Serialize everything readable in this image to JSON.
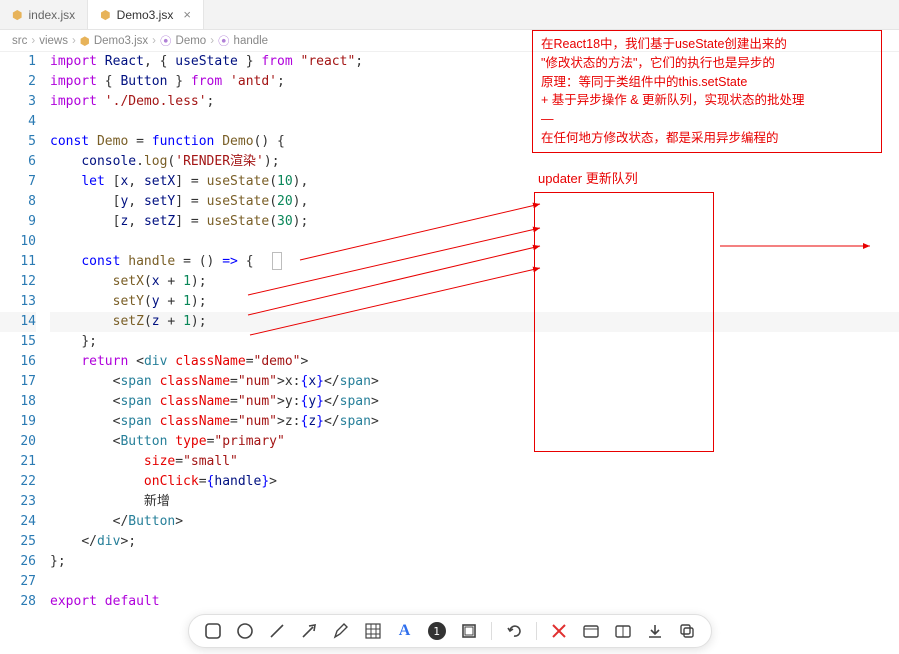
{
  "tabs": [
    {
      "label": "index.jsx",
      "active": false
    },
    {
      "label": "Demo3.jsx",
      "active": true
    }
  ],
  "breadcrumbs": {
    "parts": [
      "src",
      "views",
      "Demo3.jsx",
      "Demo",
      "handle"
    ]
  },
  "line_numbers": [
    "1",
    "2",
    "3",
    "4",
    "5",
    "6",
    "7",
    "8",
    "9",
    "10",
    "11",
    "12",
    "13",
    "14",
    "15",
    "16",
    "17",
    "18",
    "19",
    "20",
    "21",
    "22",
    "23",
    "24",
    "25",
    "26",
    "27",
    "28"
  ],
  "code": {
    "l1": {
      "a": "import",
      "b": "React",
      "c": ", { ",
      "d": "useState",
      "e": " } ",
      "f": "from",
      "g": "\"react\"",
      "h": ";"
    },
    "l2": {
      "a": "import",
      "b": " { ",
      "c": "Button",
      "d": " } ",
      "e": "from",
      "f": "'antd'",
      "g": ";"
    },
    "l3": {
      "a": "import",
      "b": "'./Demo.less'",
      "c": ";"
    },
    "l5": {
      "a": "const",
      "b": "Demo",
      "c": " = ",
      "d": "function",
      "e": "Demo",
      "f": "() {"
    },
    "l6": {
      "a": "console",
      "b": ".",
      "c": "log",
      "d": "(",
      "e": "'RENDER渲染'",
      "f": ");"
    },
    "l7": {
      "a": "let",
      "b": " [",
      "c": "x",
      "d": ", ",
      "e": "setX",
      "f": "] = ",
      "g": "useState",
      "h": "(",
      "i": "10",
      "j": "),"
    },
    "l8": {
      "a": "[",
      "b": "y",
      "c": ", ",
      "d": "setY",
      "e": "] = ",
      "f": "useState",
      "g": "(",
      "h": "20",
      "i": "),"
    },
    "l9": {
      "a": "[",
      "b": "z",
      "c": ", ",
      "d": "setZ",
      "e": "] = ",
      "f": "useState",
      "g": "(",
      "h": "30",
      "i": ");"
    },
    "l11": {
      "a": "const",
      "b": "handle",
      "c": " = () ",
      "d": "=>",
      "e": " {"
    },
    "l12": {
      "a": "setX",
      "b": "(",
      "c": "x",
      "d": " + ",
      "e": "1",
      "f": ");"
    },
    "l13": {
      "a": "setY",
      "b": "(",
      "c": "y",
      "d": " + ",
      "e": "1",
      "f": ");"
    },
    "l14": {
      "a": "setZ",
      "b": "(",
      "c": "z",
      "d": " + ",
      "e": "1",
      "f": ");"
    },
    "l15": {
      "a": "};"
    },
    "l16": {
      "a": "return",
      "b": "<",
      "c": "div",
      "d": "className",
      "e": "=",
      "f": "\"demo\"",
      "g": ">"
    },
    "l17": {
      "a": "<",
      "b": "span",
      "c": "className",
      "d": "=",
      "e": "\"num\"",
      "f": ">x:",
      "g": "{",
      "h": "x",
      "i": "}",
      "j": "</",
      "k": "span",
      "l": ">"
    },
    "l18": {
      "a": "<",
      "b": "span",
      "c": "className",
      "d": "=",
      "e": "\"num\"",
      "f": ">y:",
      "g": "{",
      "h": "y",
      "i": "}",
      "j": "</",
      "k": "span",
      "l": ">"
    },
    "l19": {
      "a": "<",
      "b": "span",
      "c": "className",
      "d": "=",
      "e": "\"num\"",
      "f": ">z:",
      "g": "{",
      "h": "z",
      "i": "}",
      "j": "</",
      "k": "span",
      "l": ">"
    },
    "l20": {
      "a": "<",
      "b": "Button",
      "c": "type",
      "d": "=",
      "e": "\"primary\""
    },
    "l21": {
      "a": "size",
      "b": "=",
      "c": "\"small\""
    },
    "l22": {
      "a": "onClick",
      "b": "=",
      "c": "{",
      "d": "handle",
      "e": "}",
      "f": ">"
    },
    "l23": {
      "a": "新增"
    },
    "l24": {
      "a": "</",
      "b": "Button",
      "c": ">"
    },
    "l25": {
      "a": "</",
      "b": "div",
      "c": ">;"
    },
    "l26": {
      "a": "};"
    },
    "l28": {
      "a": "export",
      "b": "default"
    }
  },
  "annotation": {
    "box_lines": [
      "在React18中，我们基于useState创建出来的",
      "\"修改状态的方法\"，它们的执行也是异步的",
      "原理：等同于类组件中的this.setState",
      "  + 基于异步操作 & 更新队列，实现状态的批处理",
      "—",
      "在任何地方修改状态，都是采用异步编程的"
    ],
    "queue_label": "updater 更新队列"
  },
  "toolbar": {
    "badge": "1"
  }
}
